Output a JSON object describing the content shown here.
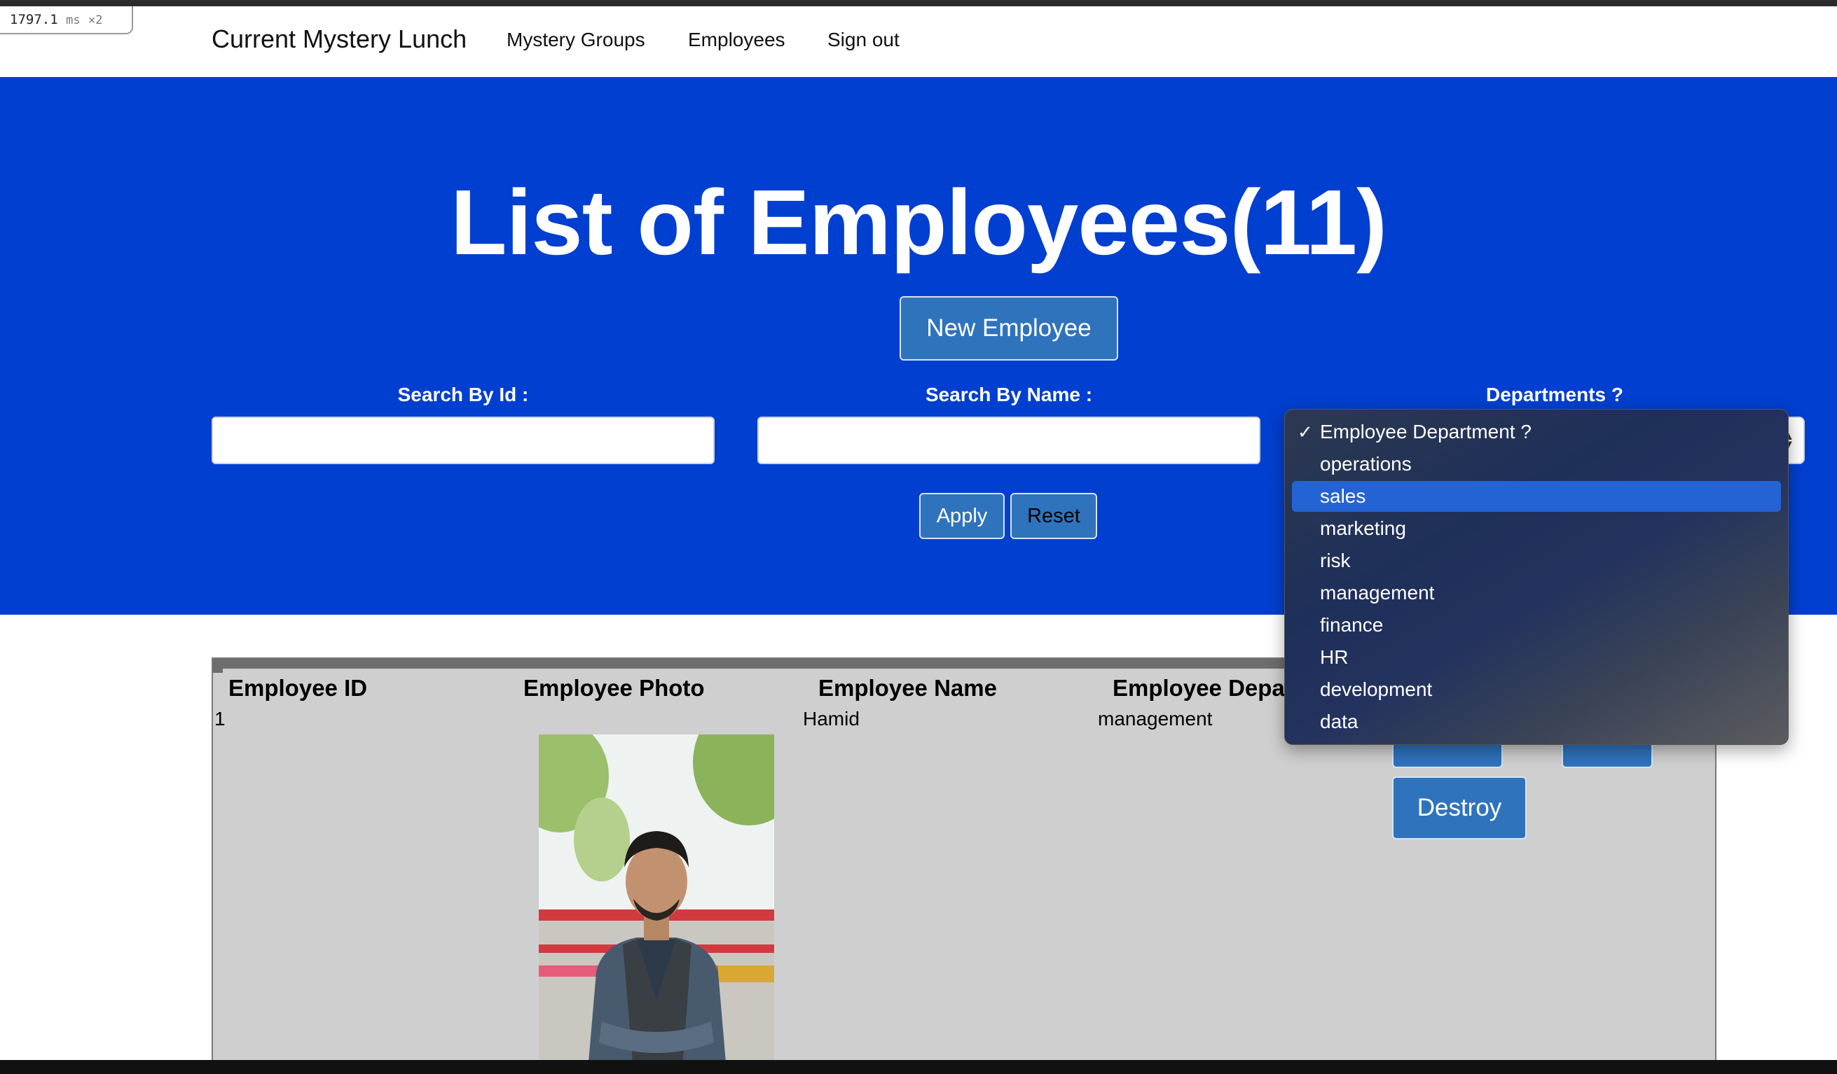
{
  "timer": {
    "value": "1797.1",
    "unit": "ms",
    "multiplier": "×2"
  },
  "nav": {
    "brand": "Current Mystery Lunch",
    "links": [
      "Mystery Groups",
      "Employees",
      "Sign out"
    ]
  },
  "hero": {
    "title": "List of Employees(11)",
    "new_button": "New Employee",
    "search_id_label": "Search By Id :",
    "search_id_value": "",
    "search_name_label": "Search By Name :",
    "search_name_value": "",
    "departments_label": "Departments ?",
    "apply": "Apply",
    "reset": "Reset"
  },
  "dropdown": {
    "checkmark": "✓",
    "selected_index": 0,
    "highlighted_index": 2,
    "options": [
      "Employee Department ?",
      "operations",
      "sales",
      "marketing",
      "risk",
      "management",
      "finance",
      "HR",
      "development",
      "data"
    ]
  },
  "table": {
    "headers": [
      "Employee ID",
      "Employee Photo",
      "Employee Name",
      "Employee Depar"
    ],
    "rows": [
      {
        "id": "1",
        "name": "Hamid",
        "department": "management",
        "destroy": "Destroy"
      }
    ]
  },
  "colors": {
    "hero_blue": "#003fd0",
    "button_blue": "#2f73bd",
    "highlight": "#2463d4",
    "table_bg": "#cfcfcf"
  }
}
